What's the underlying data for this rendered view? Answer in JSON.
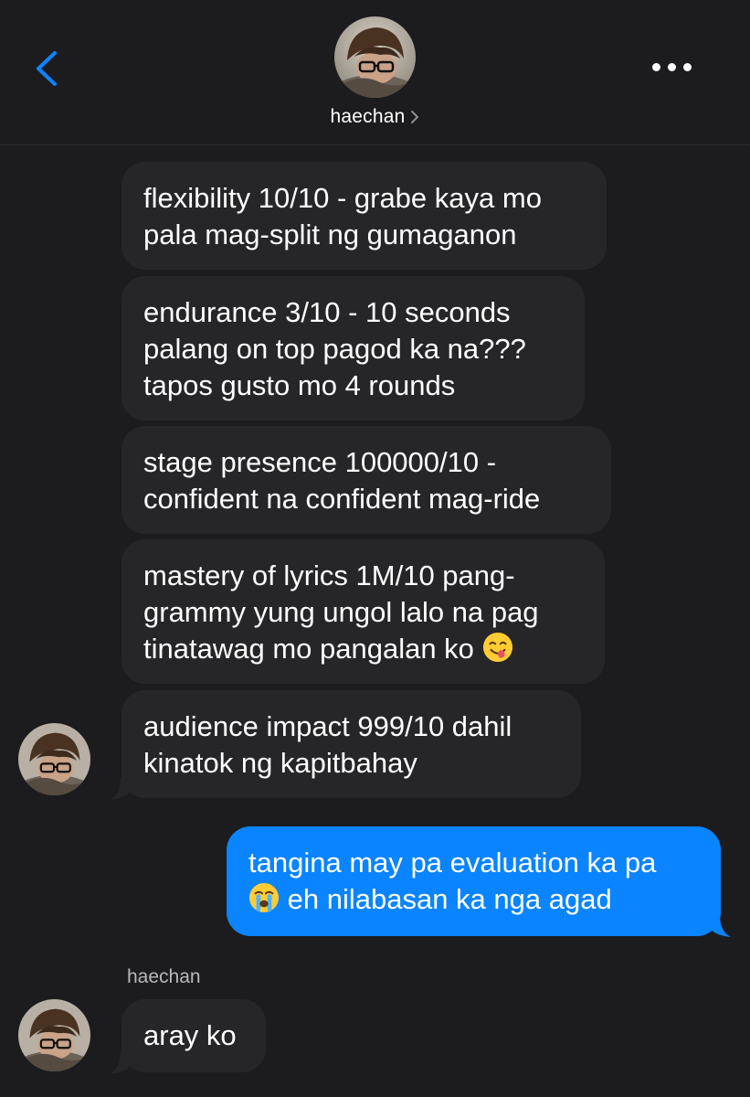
{
  "colors": {
    "background": "#1c1c1e",
    "incoming_bubble": "#262628",
    "outgoing_bubble": "#0a84ff",
    "accent": "#0a84ff",
    "text": "#ffffff",
    "secondary_text": "#b8b8bc"
  },
  "header": {
    "back_icon": "chevron-left-icon",
    "contact_name": "haechan",
    "chevron_icon": "chevron-right-icon",
    "more_icon": "ellipsis-icon"
  },
  "messages": [
    {
      "direction": "incoming",
      "lines": [
        "flexibility 10/10 - grabe kaya mo",
        "pala mag-split ng gumaganon"
      ]
    },
    {
      "direction": "incoming",
      "lines": [
        "endurance 3/10 - 10 seconds",
        "palang on top pagod ka na???",
        "tapos gusto mo 4 rounds"
      ]
    },
    {
      "direction": "incoming",
      "lines": [
        "stage presence 100000/10 -",
        "confident na confident mag-ride"
      ]
    },
    {
      "direction": "incoming",
      "lines": [
        "mastery of lyrics 1M/10 pang-",
        "grammy yung ungol lalo na pag",
        "tinatawag mo pangalan ko"
      ],
      "emoji": "face-savoring-food-emoji"
    },
    {
      "direction": "incoming",
      "lines": [
        "audience impact 999/10 dahil",
        "kinatok ng kapitbahay"
      ]
    },
    {
      "direction": "outgoing",
      "lines": [
        "tangina may pa evaluation ka pa",
        "eh nilabasan ka nga agad"
      ],
      "emoji": "loudly-crying-face-emoji"
    },
    {
      "direction": "incoming",
      "sender": "haechan",
      "lines": [
        "aray ko"
      ]
    }
  ]
}
